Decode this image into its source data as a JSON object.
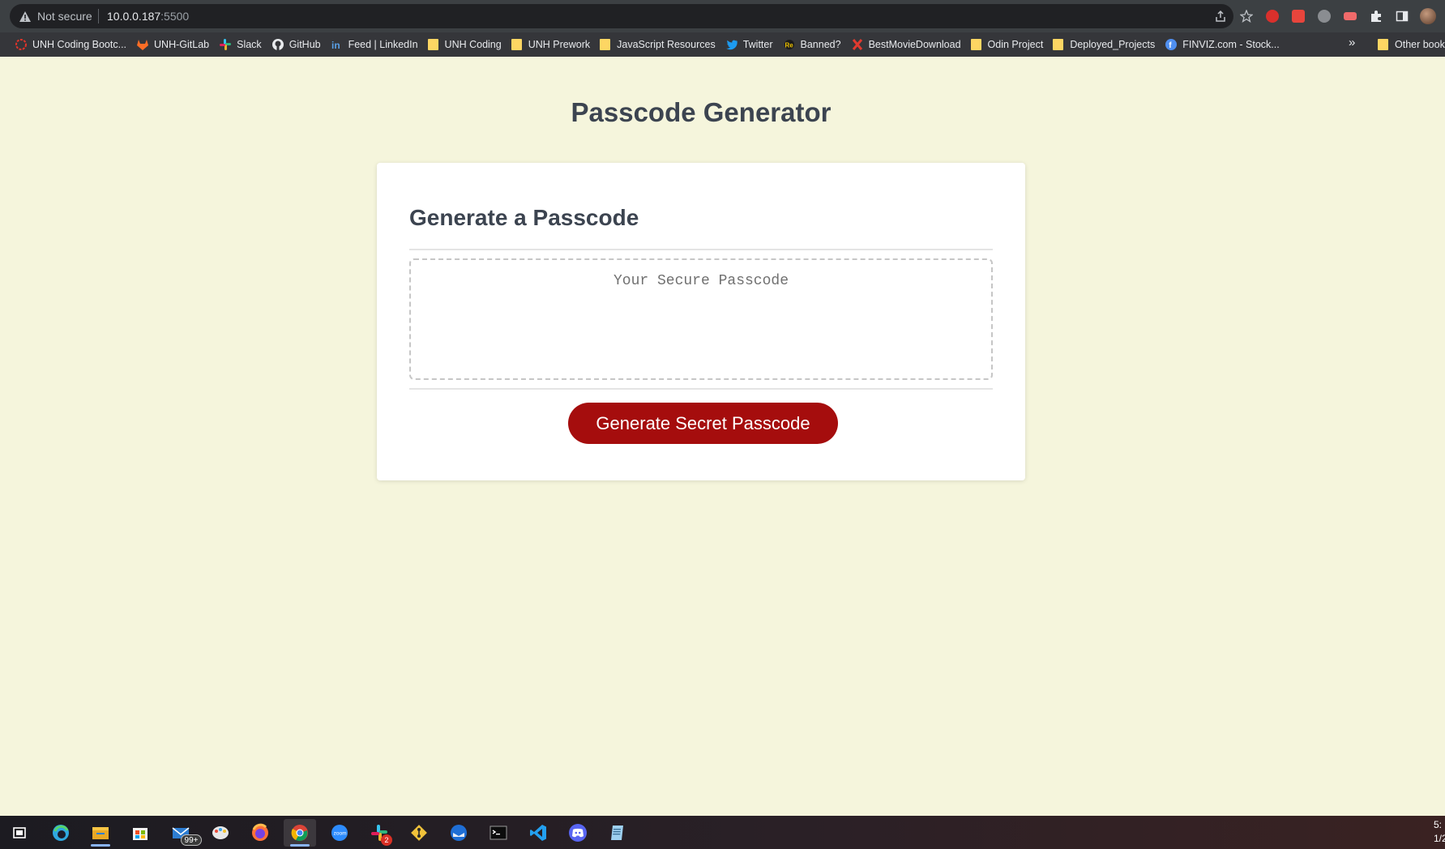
{
  "browser": {
    "security_label": "Not secure",
    "url_host": "10.0.0.187",
    "url_port": ":5500",
    "bookmarks": [
      {
        "label": "UNH Coding Bootc...",
        "icon": "unh-bootcamp-icon"
      },
      {
        "label": "UNH-GitLab",
        "icon": "gitlab-icon"
      },
      {
        "label": "Slack",
        "icon": "slack-icon"
      },
      {
        "label": "GitHub",
        "icon": "github-icon"
      },
      {
        "label": "Feed | LinkedIn",
        "icon": "linkedin-icon"
      },
      {
        "label": "UNH Coding",
        "icon": "folder-icon"
      },
      {
        "label": "UNH Prework",
        "icon": "folder-icon"
      },
      {
        "label": "JavaScript Resources",
        "icon": "folder-icon"
      },
      {
        "label": "Twitter",
        "icon": "twitter-icon"
      },
      {
        "label": "Banned?",
        "icon": "banned-icon"
      },
      {
        "label": "BestMovieDownload",
        "icon": "x-icon"
      },
      {
        "label": "Odin Project",
        "icon": "folder-icon"
      },
      {
        "label": "Deployed_Projects",
        "icon": "folder-icon"
      },
      {
        "label": "FINVIZ.com - Stock...",
        "icon": "finviz-icon"
      }
    ],
    "more_label": "»",
    "other_bookmarks_label": "Other book"
  },
  "page": {
    "title": "Passcode Generator",
    "card_title": "Generate a Passcode",
    "passcode_placeholder": "Your Secure Passcode",
    "generate_button_label": "Generate Secret Passcode"
  },
  "taskbar": {
    "mail_badge": "99+",
    "slack_badge": "2",
    "clock_time": "5:",
    "clock_date": "1/2"
  },
  "colors": {
    "page_background": "#f5f5dc",
    "button": "#a50d0d",
    "heading": "#3c4450"
  }
}
